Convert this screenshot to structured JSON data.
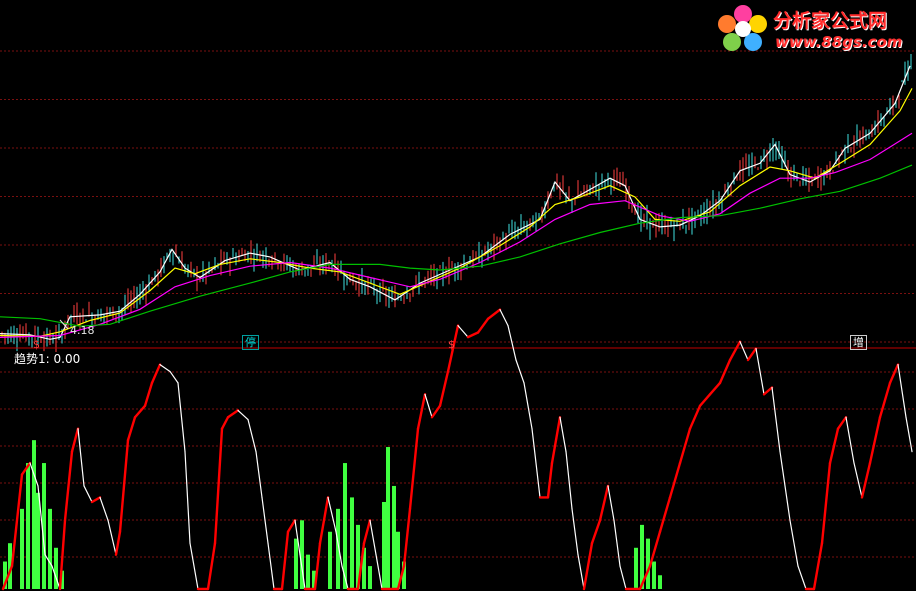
{
  "watermark": {
    "title": "分析家公式网",
    "url": "www.88gs.com"
  },
  "price_label": "4.18",
  "signals": {
    "s1": "$",
    "stop": "停",
    "s2": "$",
    "add": "增"
  },
  "indicator_label": "趋势1: 0.00",
  "colors": {
    "background": "#000000",
    "grid": "#7a1010",
    "separator": "#c00000",
    "ma_fast": "#ffffff",
    "ma_mid": "#ffff00",
    "ma_slow": "#ff00ff",
    "ma_long": "#00c000",
    "trend_up": "#ff0000",
    "trend_down": "#ffffff",
    "hist": "#40ff40"
  },
  "chart_data": [
    {
      "type": "line",
      "panel": "price",
      "x_range": [
        0,
        916
      ],
      "y_range": [
        3.6,
        12.6
      ],
      "series": [
        {
          "name": "",
          "color": "#ffffff",
          "points": [
            [
              0,
              3.85
            ],
            [
              30,
              3.82
            ],
            [
              50,
              3.7
            ],
            [
              60,
              3.75
            ],
            [
              70,
              4.3
            ],
            [
              100,
              4.35
            ],
            [
              120,
              4.45
            ],
            [
              140,
              4.9
            ],
            [
              160,
              5.5
            ],
            [
              172,
              6.1
            ],
            [
              185,
              5.6
            ],
            [
              200,
              5.35
            ],
            [
              225,
              5.8
            ],
            [
              250,
              6.0
            ],
            [
              270,
              5.9
            ],
            [
              300,
              5.55
            ],
            [
              330,
              5.75
            ],
            [
              350,
              5.3
            ],
            [
              370,
              5.1
            ],
            [
              395,
              4.75
            ],
            [
              420,
              5.2
            ],
            [
              450,
              5.55
            ],
            [
              480,
              5.9
            ],
            [
              510,
              6.5
            ],
            [
              540,
              6.9
            ],
            [
              555,
              7.9
            ],
            [
              570,
              7.4
            ],
            [
              590,
              7.7
            ],
            [
              610,
              8.0
            ],
            [
              625,
              7.8
            ],
            [
              640,
              6.9
            ],
            [
              660,
              6.7
            ],
            [
              680,
              6.75
            ],
            [
              700,
              7.0
            ],
            [
              720,
              7.4
            ],
            [
              740,
              8.2
            ],
            [
              760,
              8.4
            ],
            [
              775,
              8.9
            ],
            [
              790,
              8.1
            ],
            [
              810,
              7.9
            ],
            [
              830,
              8.2
            ],
            [
              845,
              8.8
            ],
            [
              870,
              9.2
            ],
            [
              895,
              10.0
            ],
            [
              910,
              11.0
            ]
          ]
        },
        {
          "name": "",
          "color": "#ffff00",
          "points": [
            [
              0,
              3.8
            ],
            [
              40,
              3.78
            ],
            [
              60,
              3.9
            ],
            [
              90,
              4.2
            ],
            [
              120,
              4.4
            ],
            [
              150,
              5.0
            ],
            [
              175,
              5.6
            ],
            [
              195,
              5.45
            ],
            [
              220,
              5.7
            ],
            [
              250,
              5.85
            ],
            [
              280,
              5.75
            ],
            [
              310,
              5.6
            ],
            [
              340,
              5.5
            ],
            [
              370,
              5.2
            ],
            [
              400,
              4.9
            ],
            [
              430,
              5.25
            ],
            [
              460,
              5.6
            ],
            [
              500,
              6.2
            ],
            [
              530,
              6.7
            ],
            [
              555,
              7.3
            ],
            [
              580,
              7.5
            ],
            [
              610,
              7.8
            ],
            [
              635,
              7.5
            ],
            [
              655,
              6.9
            ],
            [
              680,
              6.85
            ],
            [
              710,
              7.1
            ],
            [
              740,
              7.8
            ],
            [
              770,
              8.3
            ],
            [
              790,
              8.2
            ],
            [
              815,
              8.0
            ],
            [
              840,
              8.4
            ],
            [
              870,
              8.9
            ],
            [
              900,
              9.8
            ],
            [
              912,
              10.4
            ]
          ]
        },
        {
          "name": "",
          "color": "#ff00ff",
          "points": [
            [
              0,
              3.75
            ],
            [
              60,
              3.8
            ],
            [
              100,
              4.1
            ],
            [
              140,
              4.5
            ],
            [
              175,
              5.1
            ],
            [
              210,
              5.4
            ],
            [
              250,
              5.65
            ],
            [
              290,
              5.75
            ],
            [
              330,
              5.6
            ],
            [
              370,
              5.35
            ],
            [
              410,
              5.1
            ],
            [
              440,
              5.3
            ],
            [
              480,
              5.75
            ],
            [
              520,
              6.3
            ],
            [
              555,
              6.9
            ],
            [
              590,
              7.3
            ],
            [
              625,
              7.4
            ],
            [
              660,
              7.0
            ],
            [
              690,
              6.85
            ],
            [
              720,
              7.05
            ],
            [
              750,
              7.6
            ],
            [
              780,
              8.0
            ],
            [
              810,
              8.0
            ],
            [
              835,
              8.15
            ],
            [
              870,
              8.5
            ],
            [
              912,
              9.2
            ]
          ]
        },
        {
          "name": "",
          "color": "#00c000",
          "points": [
            [
              0,
              4.3
            ],
            [
              40,
              4.25
            ],
            [
              80,
              4.05
            ],
            [
              110,
              4.1
            ],
            [
              150,
              4.45
            ],
            [
              200,
              4.85
            ],
            [
              250,
              5.2
            ],
            [
              290,
              5.5
            ],
            [
              330,
              5.7
            ],
            [
              380,
              5.7
            ],
            [
              410,
              5.6
            ],
            [
              440,
              5.55
            ],
            [
              480,
              5.65
            ],
            [
              520,
              5.9
            ],
            [
              560,
              6.25
            ],
            [
              600,
              6.55
            ],
            [
              640,
              6.8
            ],
            [
              680,
              6.95
            ],
            [
              720,
              7.0
            ],
            [
              760,
              7.2
            ],
            [
              800,
              7.45
            ],
            [
              840,
              7.65
            ],
            [
              880,
              8.0
            ],
            [
              912,
              8.35
            ]
          ]
        }
      ]
    },
    {
      "type": "line",
      "panel": "indicator",
      "title": "趋势1",
      "x_range": [
        0,
        916
      ],
      "y_range": [
        0,
        100
      ],
      "series": [
        {
          "name": "",
          "color": "#ff0000",
          "points": [
            [
              3,
              0
            ],
            [
              12,
              10
            ],
            [
              22,
              50
            ],
            [
              30,
              55
            ],
            [
              38,
              45
            ],
            [
              45,
              15
            ],
            [
              52,
              10
            ],
            [
              60,
              0
            ],
            [
              65,
              30
            ],
            [
              72,
              60
            ],
            [
              78,
              70
            ],
            [
              84,
              45
            ],
            [
              92,
              38
            ],
            [
              100,
              40
            ],
            [
              108,
              30
            ],
            [
              116,
              15
            ],
            [
              120,
              25
            ],
            [
              128,
              65
            ],
            [
              135,
              75
            ],
            [
              145,
              80
            ],
            [
              152,
              90
            ],
            [
              160,
              98
            ],
            [
              170,
              95
            ],
            [
              178,
              90
            ],
            [
              185,
              60
            ],
            [
              190,
              20
            ],
            [
              198,
              0
            ],
            [
              208,
              0
            ],
            [
              215,
              20
            ],
            [
              222,
              70
            ],
            [
              228,
              75
            ],
            [
              238,
              78
            ],
            [
              248,
              74
            ],
            [
              256,
              60
            ],
            [
              262,
              40
            ],
            [
              268,
              20
            ],
            [
              274,
              0
            ],
            [
              282,
              0
            ],
            [
              288,
              25
            ],
            [
              295,
              30
            ],
            [
              300,
              15
            ],
            [
              305,
              0
            ],
            [
              315,
              0
            ],
            [
              320,
              20
            ],
            [
              328,
              40
            ],
            [
              336,
              25
            ],
            [
              342,
              10
            ],
            [
              348,
              0
            ],
            [
              358,
              0
            ],
            [
              364,
              20
            ],
            [
              370,
              30
            ],
            [
              376,
              15
            ],
            [
              382,
              0
            ],
            [
              398,
              0
            ],
            [
              404,
              10
            ],
            [
              410,
              35
            ],
            [
              418,
              70
            ],
            [
              425,
              85
            ],
            [
              432,
              75
            ],
            [
              440,
              80
            ],
            [
              448,
              95
            ],
            [
              458,
              115
            ],
            [
              468,
              110
            ],
            [
              478,
              112
            ],
            [
              488,
              118
            ],
            [
              500,
              122
            ],
            [
              508,
              115
            ],
            [
              516,
              100
            ],
            [
              524,
              90
            ],
            [
              532,
              70
            ],
            [
              540,
              40
            ],
            [
              548,
              40
            ],
            [
              552,
              55
            ],
            [
              560,
              75
            ],
            [
              566,
              60
            ],
            [
              572,
              35
            ],
            [
              578,
              15
            ],
            [
              584,
              0
            ],
            [
              592,
              20
            ],
            [
              600,
              30
            ],
            [
              608,
              45
            ],
            [
              614,
              30
            ],
            [
              620,
              10
            ],
            [
              626,
              0
            ],
            [
              640,
              0
            ],
            [
              650,
              10
            ],
            [
              660,
              25
            ],
            [
              670,
              40
            ],
            [
              680,
              55
            ],
            [
              690,
              70
            ],
            [
              700,
              80
            ],
            [
              710,
              85
            ],
            [
              720,
              90
            ],
            [
              730,
              100
            ],
            [
              740,
              108
            ],
            [
              748,
              100
            ],
            [
              756,
              105
            ],
            [
              764,
              85
            ],
            [
              772,
              88
            ],
            [
              780,
              60
            ],
            [
              790,
              30
            ],
            [
              798,
              10
            ],
            [
              806,
              0
            ],
            [
              814,
              0
            ],
            [
              822,
              20
            ],
            [
              830,
              55
            ],
            [
              838,
              70
            ],
            [
              846,
              75
            ],
            [
              854,
              55
            ],
            [
              862,
              40
            ],
            [
              870,
              55
            ],
            [
              880,
              75
            ],
            [
              890,
              90
            ],
            [
              898,
              98
            ],
            [
              906,
              75
            ],
            [
              912,
              60
            ]
          ]
        }
      ],
      "histogram": {
        "color": "#40ff40",
        "bars": [
          [
            5,
            12
          ],
          [
            10,
            20
          ],
          [
            22,
            35
          ],
          [
            28,
            55
          ],
          [
            34,
            65
          ],
          [
            38,
            42
          ],
          [
            44,
            55
          ],
          [
            50,
            35
          ],
          [
            56,
            18
          ],
          [
            62,
            8
          ],
          [
            296,
            22
          ],
          [
            302,
            30
          ],
          [
            308,
            15
          ],
          [
            314,
            8
          ],
          [
            330,
            25
          ],
          [
            338,
            35
          ],
          [
            345,
            55
          ],
          [
            352,
            40
          ],
          [
            358,
            28
          ],
          [
            364,
            18
          ],
          [
            370,
            10
          ],
          [
            384,
            38
          ],
          [
            388,
            62
          ],
          [
            394,
            45
          ],
          [
            398,
            25
          ],
          [
            404,
            12
          ],
          [
            636,
            18
          ],
          [
            642,
            28
          ],
          [
            648,
            22
          ],
          [
            654,
            12
          ],
          [
            660,
            6
          ]
        ]
      }
    }
  ]
}
